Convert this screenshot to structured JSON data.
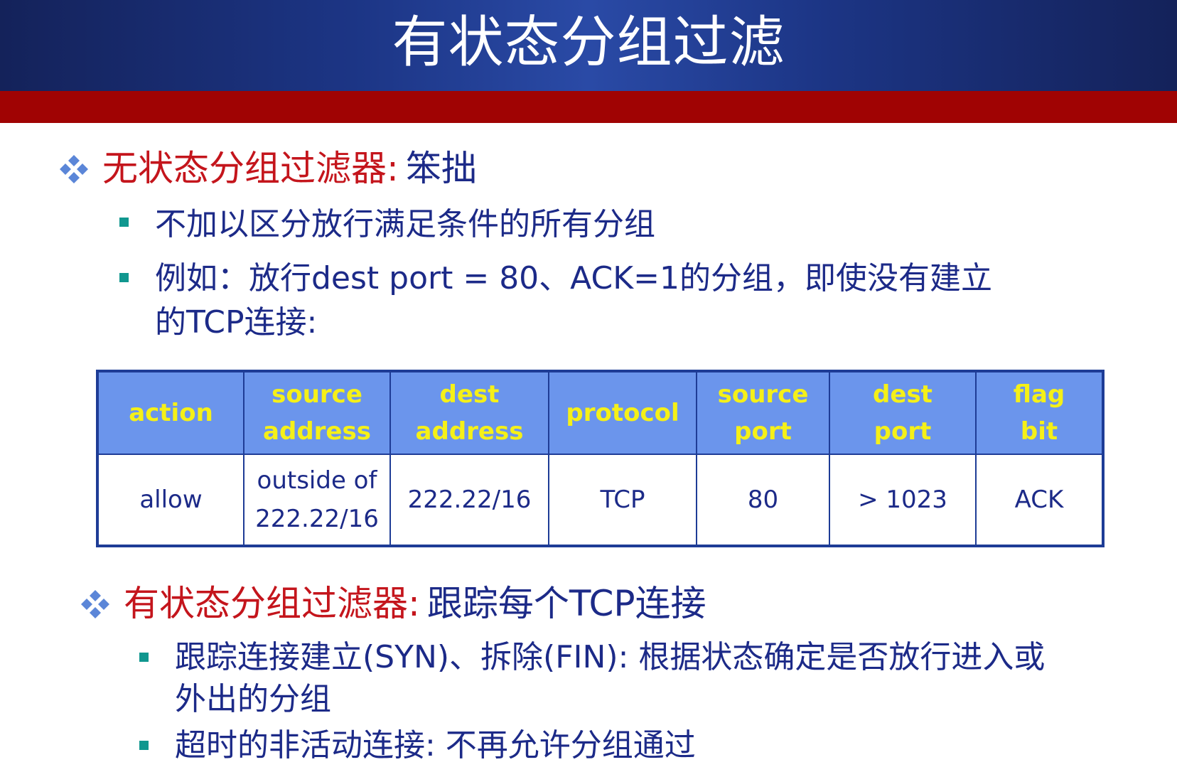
{
  "title": "有状态分组过滤",
  "section1": {
    "heading_red": "无状态分组过滤器:",
    "heading_rest": "笨拙",
    "bullets": [
      "不加以区分放行满足条件的所有分组",
      "例如：放行dest port = 80、ACK=1的分组，即使没有建立",
      "的TCP连接:"
    ]
  },
  "table": {
    "headers": [
      [
        "action"
      ],
      [
        "source",
        "address"
      ],
      [
        "dest",
        "address"
      ],
      [
        "protocol"
      ],
      [
        "source",
        "port"
      ],
      [
        "dest",
        "port"
      ],
      [
        "flag",
        "bit"
      ]
    ],
    "row": [
      [
        "allow"
      ],
      [
        "outside of",
        "222.22/16"
      ],
      [
        "222.22/16"
      ],
      [
        "TCP"
      ],
      [
        "80"
      ],
      [
        "> 1023"
      ],
      [
        "ACK"
      ]
    ]
  },
  "section2": {
    "heading_red": "有状态分组过滤器:",
    "heading_rest": "跟踪每个TCP连接",
    "bullets": [
      "跟踪连接建立(SYN)、拆除(FIN): 根据状态确定是否放行进入或",
      "外出的分组",
      "超时的非活动连接: 不再允许分组通过"
    ]
  },
  "colors": {
    "header_blue": "#1c3585",
    "band_red": "#a00303",
    "heading_red": "#c4151c",
    "text_navy": "#1c2a88",
    "bullet_teal": "#10978f",
    "table_header_bg": "#6b95ec",
    "table_header_text": "#f5f018"
  },
  "icons": {
    "level1_bullet": "four-diamond-icon",
    "level2_bullet": "square-bullet-icon"
  }
}
